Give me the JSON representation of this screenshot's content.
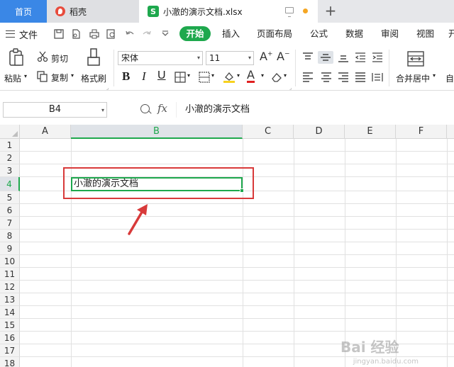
{
  "tabs": {
    "home": "首页",
    "daoke": "稻壳",
    "file": "小澈的演示文档.xlsx",
    "xls_badge": "S",
    "add": "+"
  },
  "menu": {
    "file": "文件",
    "start": "开始",
    "items": [
      "插入",
      "页面布局",
      "公式",
      "数据",
      "审阅",
      "视图",
      "开"
    ]
  },
  "ribbon": {
    "paste": "粘贴",
    "cut": "剪切",
    "copy": "复制",
    "format_painter": "格式刷",
    "font_name": "宋体",
    "font_size": "11",
    "bold": "B",
    "italic": "I",
    "underline": "U",
    "font_color_letter": "A",
    "merge_center": "合并居中",
    "auto_wrap": "自"
  },
  "formula_bar": {
    "cell_ref": "B4",
    "fx": "fx",
    "content": "小澈的演示文档"
  },
  "sheet": {
    "columns": [
      "A",
      "B",
      "C",
      "D",
      "E",
      "F"
    ],
    "active_column": "B",
    "rows": [
      "1",
      "2",
      "3",
      "4",
      "5",
      "6",
      "7",
      "8",
      "9",
      "10",
      "11",
      "12",
      "13",
      "14",
      "15",
      "16",
      "17",
      "18"
    ],
    "active_row": "4",
    "cell_b4": "小澈的演示文档"
  },
  "watermark": {
    "main": "Bai 经验",
    "sub": "jingyan.baidu.com"
  },
  "colors": {
    "accent_green": "#1ea84d",
    "home_tab_blue": "#3a87e6",
    "annotation_red": "#d83a3a"
  }
}
